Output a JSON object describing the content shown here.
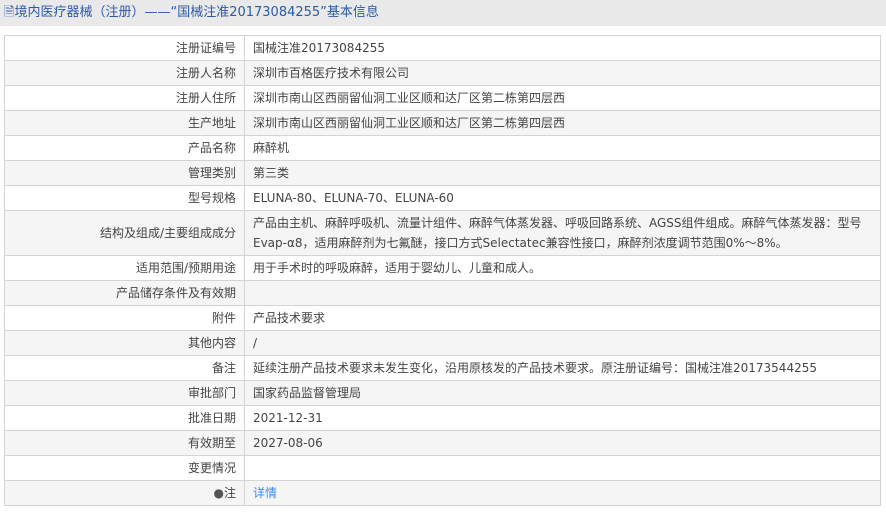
{
  "header": {
    "title": "境内医疗器械（注册）——“国械注准20173084255”基本信息"
  },
  "rows": [
    {
      "label": "注册证编号",
      "value": "国械注准20173084255"
    },
    {
      "label": "注册人名称",
      "value": "深圳市百格医疗技术有限公司"
    },
    {
      "label": "注册人住所",
      "value": "深圳市南山区西丽留仙洞工业区顺和达厂区第二栋第四层西"
    },
    {
      "label": "生产地址",
      "value": "深圳市南山区西丽留仙洞工业区顺和达厂区第二栋第四层西"
    },
    {
      "label": "产品名称",
      "value": "麻醉机"
    },
    {
      "label": "管理类别",
      "value": "第三类"
    },
    {
      "label": "型号规格",
      "value": "ELUNA-80、ELUNA-70、ELUNA-60"
    },
    {
      "label": "结构及组成/主要组成成分",
      "value": "产品由主机、麻醉呼吸机、流量计组件、麻醉气体蒸发器、呼吸回路系统、AGSS组件组成。麻醉气体蒸发器：型号Evap-α8，适用麻醉剂为七氟醚，接口方式Selectatec兼容性接口，麻醉剂浓度调节范围0%～8%。"
    },
    {
      "label": "适用范围/预期用途",
      "value": "用于手术时的呼吸麻醉，适用于婴幼儿、儿童和成人。"
    },
    {
      "label": "产品储存条件及有效期",
      "value": ""
    },
    {
      "label": "附件",
      "value": "产品技术要求"
    },
    {
      "label": "其他内容",
      "value": "/"
    },
    {
      "label": "备注",
      "value": "延续注册产品技术要求未发生变化，沿用原核发的产品技术要求。原注册证编号：国械注准20173544255"
    },
    {
      "label": "审批部门",
      "value": "国家药品监督管理局"
    },
    {
      "label": "批准日期",
      "value": "2021-12-31"
    },
    {
      "label": "有效期至",
      "value": "2027-08-06"
    },
    {
      "label": "变更情况",
      "value": ""
    }
  ],
  "note": {
    "label": "注",
    "link": "详情"
  }
}
